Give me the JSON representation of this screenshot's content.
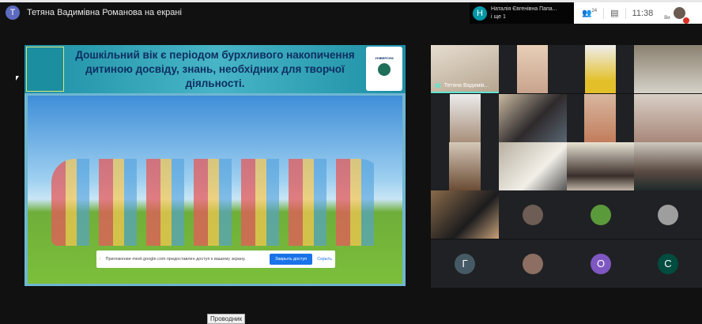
{
  "presenter": {
    "initial": "Т",
    "title": "Тетяна Вадимівна Романова на екрані",
    "color": "#5c6bc0"
  },
  "notification": {
    "initial": "Н",
    "name": "Наталія Євгенівна Папа...",
    "more": "і ще 1",
    "color": "#0097a7"
  },
  "controls": {
    "participants_count": "24",
    "time": "11:38",
    "self_label": "Ви"
  },
  "slide": {
    "title": "Дошкільний вік є періодом бурхливого накопичення дитиною досвіду, знань, необхідних для творчої діяльності.",
    "logo_right": "УНІВЕРСУМ"
  },
  "share_bar": {
    "message": "Приложение meet.google.com предоставлен доступ к вашему экрану.",
    "stop_label": "Закрыть доступ",
    "hide_label": "Скрыть"
  },
  "tiles": [
    {
      "name": "Тетяна Вадимів...",
      "speaking": true
    },
    {},
    {},
    {},
    {},
    {},
    {},
    {},
    {},
    {},
    {},
    {},
    {}
  ],
  "avatar_tiles": [
    {
      "initial": "Г",
      "color": "#455a64"
    },
    {
      "initial": "",
      "color": "#8d6e63"
    },
    {
      "initial": "О",
      "color": "#7e57c2"
    },
    {
      "initial": "С",
      "color": "#004d40"
    }
  ],
  "photo_avatars": [
    {
      "color": "#6d5d55"
    },
    {
      "color": "#5a9a3a"
    },
    {
      "color": "#9e9e9e"
    }
  ],
  "taskbar": {
    "tooltip": "Проводник"
  }
}
